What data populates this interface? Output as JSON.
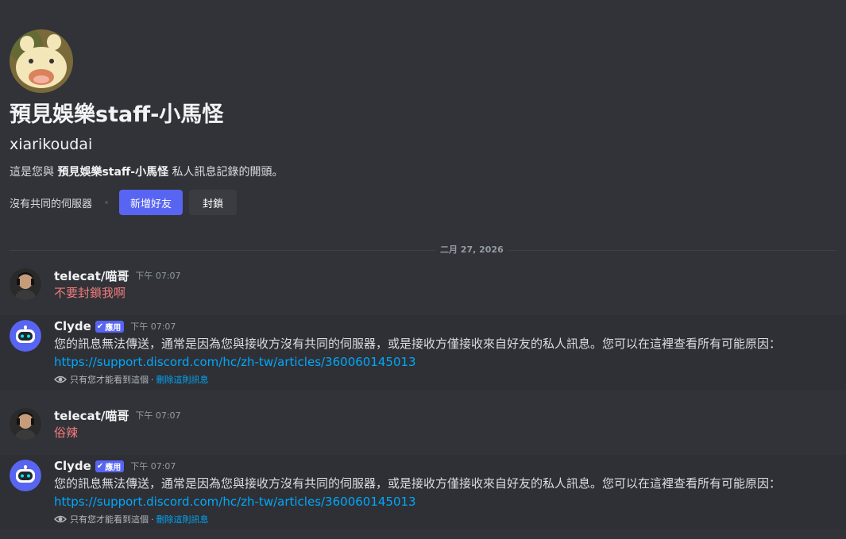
{
  "intro": {
    "display_name": "預見娛樂staff-小馬怪",
    "username": "xiarikoudai",
    "description_prefix": "這是您與",
    "description_name": "預見娛樂staff-小馬怪",
    "description_suffix": "私人訊息記錄的開頭。",
    "no_mutual_servers": "沒有共同的伺服器",
    "add_friend_label": "新增好友",
    "block_label": "封鎖"
  },
  "date_divider": "二月 27, 2026",
  "messages": [
    {
      "author": "telecat/喵哥",
      "time": "下午 07:07",
      "content": "不要封鎖我啊"
    },
    {
      "author": "Clyde",
      "tag": "應用",
      "time": "下午 07:07",
      "content": "您的訊息無法傳送，通常是因為您與接收方沒有共同的伺服器，或是接收方僅接收來自好友的私人訊息。您可以在這裡查看所有可能原因：",
      "link": "https://support.discord.com/hc/zh-tw/articles/360060145013",
      "ephemeral_note": "只有您才能看到這個",
      "dismiss_label": "刪除這則訊息"
    },
    {
      "author": "telecat/喵哥",
      "time": "下午 07:07",
      "content": "俗辣"
    },
    {
      "author": "Clyde",
      "tag": "應用",
      "time": "下午 07:07",
      "content": "您的訊息無法傳送，通常是因為您與接收方沒有共同的伺服器，或是接收方僅接收來自好友的私人訊息。您可以在這裡查看所有可能原因：",
      "link": "https://support.discord.com/hc/zh-tw/articles/360060145013",
      "ephemeral_note": "只有您才能看到這個",
      "dismiss_label": "刪除這則訊息"
    }
  ],
  "colors": {
    "background": "#313338",
    "blurple": "#5865f2",
    "link": "#00a8fc",
    "red_text": "#f47b7b"
  }
}
